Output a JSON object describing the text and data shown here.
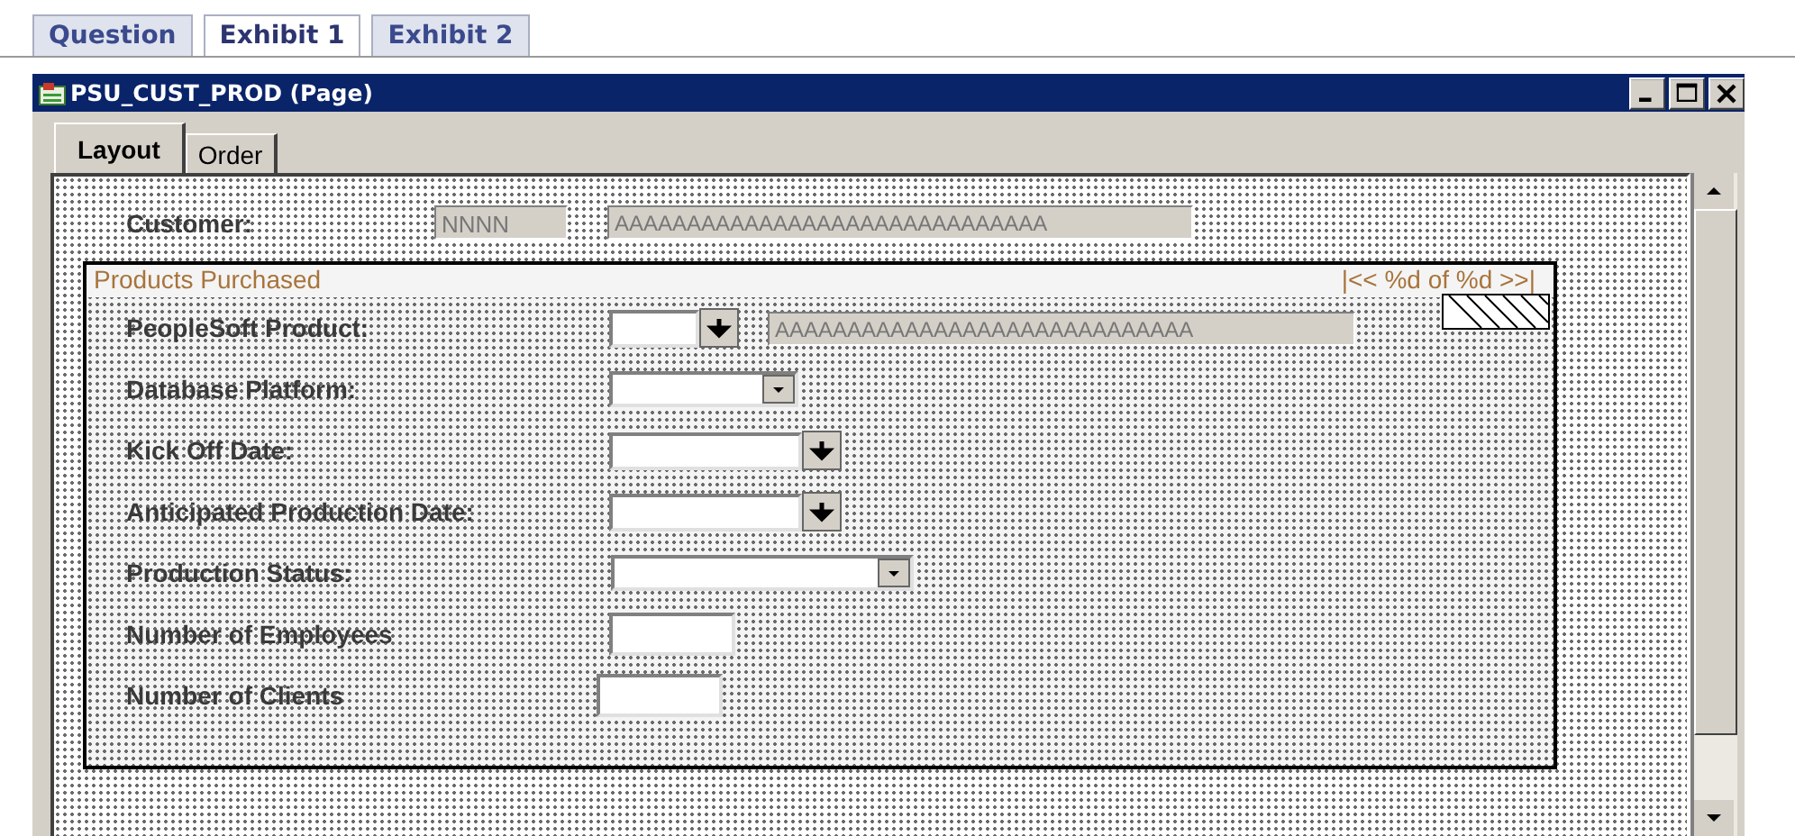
{
  "tabs": [
    {
      "label": "Question",
      "selected": false
    },
    {
      "label": "Exhibit 1",
      "selected": true
    },
    {
      "label": "Exhibit 2",
      "selected": false
    }
  ],
  "window": {
    "title": "PSU_CUST_PROD (Page)"
  },
  "page_tabs": [
    {
      "label": "Layout",
      "selected": true
    },
    {
      "label": "Order",
      "selected": false
    }
  ],
  "customer": {
    "label": "Customer:",
    "id_value": "NNNN",
    "name_value": "AAAAAAAAAAAAAAAAAAAAAAAAAAAAAA"
  },
  "group": {
    "title": "Products Purchased",
    "navigation": "|<< %d of %d >>|",
    "rows": [
      {
        "label": "PeopleSoft Product:",
        "kind": "prompt",
        "description": "AAAAAAAAAAAAAAAAAAAAAAAAAAAAA"
      },
      {
        "label": "Database Platform:",
        "kind": "dropdown"
      },
      {
        "label": "Kick Off Date:",
        "kind": "prompt"
      },
      {
        "label": "Anticipated Production Date:",
        "kind": "prompt"
      },
      {
        "label": "Production Status:",
        "kind": "dropdown"
      },
      {
        "label": "Number of Employees",
        "kind": "edit"
      },
      {
        "label": "Number of Clients",
        "kind": "edit"
      }
    ]
  }
}
